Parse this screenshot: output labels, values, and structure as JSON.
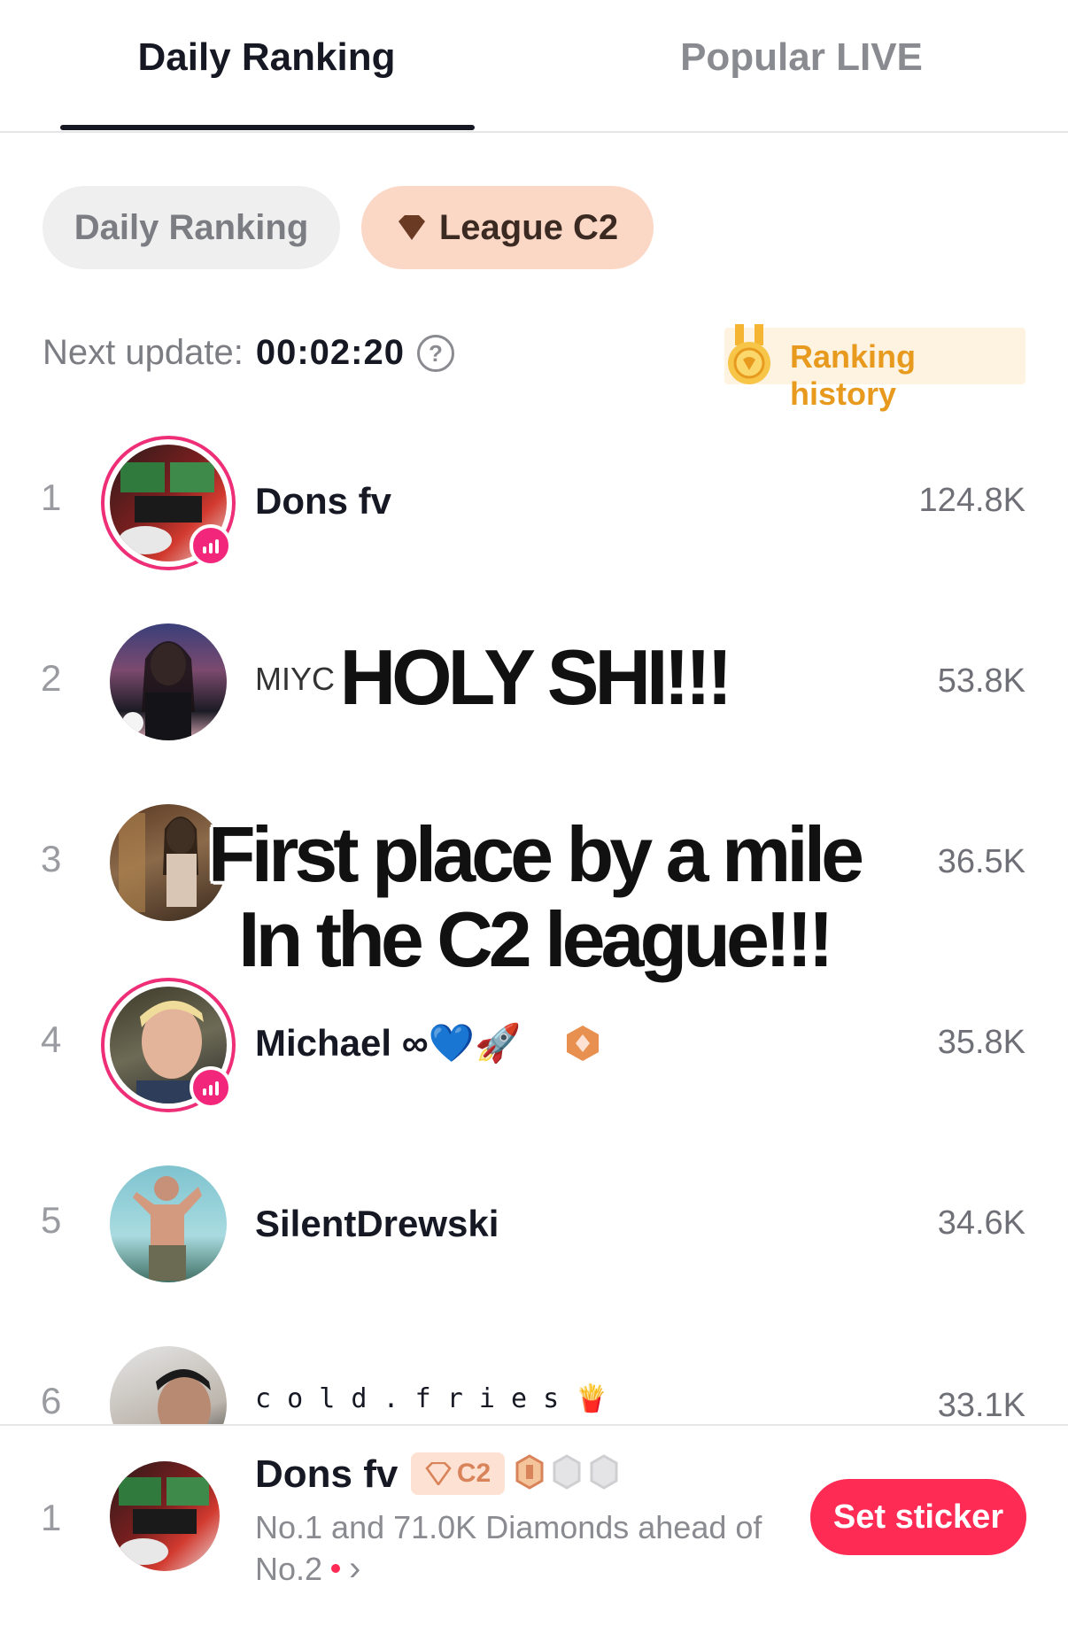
{
  "tabs": {
    "active": "Daily Ranking",
    "inactive": "Popular LIVE"
  },
  "pills": {
    "daily": "Daily Ranking",
    "league": "League C2"
  },
  "update": {
    "label": "Next update:",
    "time": "00:02:20",
    "help": "?"
  },
  "history": {
    "label": "Ranking history"
  },
  "ranking": [
    {
      "rank": "1",
      "name": "Dons fv",
      "score": "124.8K",
      "live": true
    },
    {
      "rank": "2",
      "name": "MIYC",
      "score": "53.8K",
      "live": false
    },
    {
      "rank": "3",
      "name": "",
      "score": "36.5K",
      "live": false
    },
    {
      "rank": "4",
      "name": "Michael ∞💙🚀",
      "score": "35.8K",
      "live": true
    },
    {
      "rank": "5",
      "name": "SilentDrewski",
      "score": "34.6K",
      "live": false
    },
    {
      "rank": "6",
      "name": "c o l d . f r i e s 🍟",
      "score": "33.1K",
      "live": false
    }
  ],
  "captions": {
    "line1": "HOLY SHI!!!",
    "line2": "First place by a mile",
    "line3": "In the C2 league!!!"
  },
  "me": {
    "rank": "1",
    "name": "Dons fv",
    "league_badge": "C2",
    "status_line1": "No.1 and 71.0K Diamonds ahead of",
    "status_line2": "No.2",
    "chevron": "›",
    "button": "Set sticker"
  },
  "colors": {
    "accent": "#fe2c55",
    "live_ring": "#ee2e77",
    "league_pill": "#fbd7c6",
    "history_text": "#e79a1d"
  }
}
